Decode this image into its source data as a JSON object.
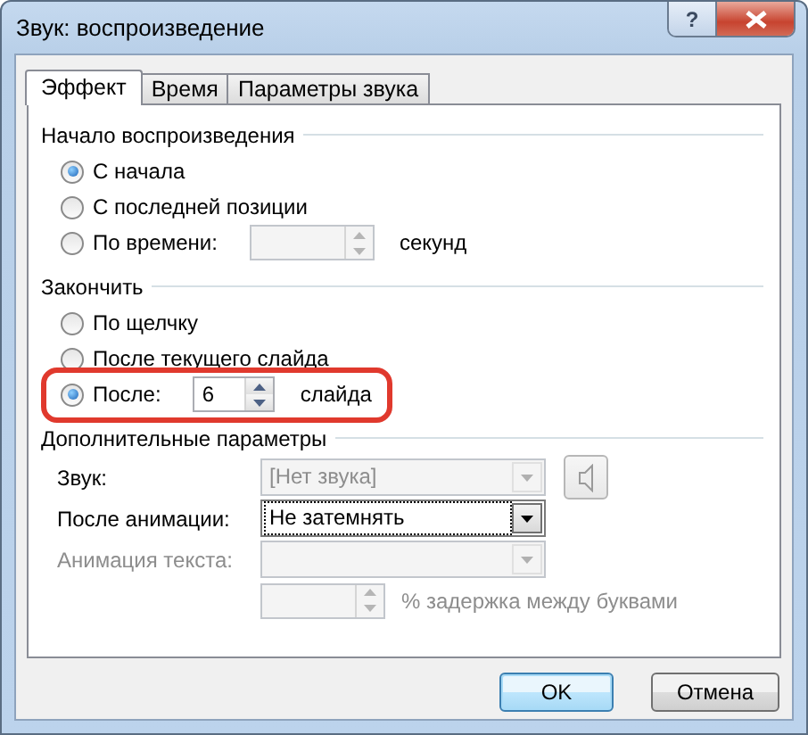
{
  "window": {
    "title": "Звук: воспроизведение",
    "help": "?"
  },
  "tabs": [
    {
      "label": "Эффект",
      "selected": true
    },
    {
      "label": "Время",
      "selected": false
    },
    {
      "label": "Параметры звука",
      "selected": false
    }
  ],
  "groups": [
    {
      "title": "Начало воспроизведения",
      "options": [
        {
          "label": "С начала",
          "selected": true,
          "kind": "plain",
          "highlighted": false
        },
        {
          "label": "С последней позиции",
          "selected": false,
          "kind": "plain",
          "highlighted": false
        },
        {
          "label": "По времени:",
          "selected": false,
          "kind": "spin",
          "field": {
            "disabled": true
          },
          "unit": "секунд",
          "highlighted": false
        }
      ]
    },
    {
      "title": "Закончить",
      "options": [
        {
          "label": "По щелчку",
          "selected": false,
          "kind": "plain",
          "highlighted": false
        },
        {
          "label": "После текущего слайда",
          "selected": false,
          "kind": "plain",
          "highlighted": false
        },
        {
          "label": "После:",
          "selected": true,
          "kind": "spin",
          "field": {
            "value": "6",
            "disabled": false
          },
          "unit": "слайда",
          "highlighted": true
        }
      ]
    }
  ],
  "extra": {
    "title": "Дополнительные параметры",
    "rows": [
      {
        "kind": "combo",
        "label": "Звук:",
        "label_disabled": false,
        "value": "[Нет звука]",
        "disabled": true,
        "focused": false,
        "speaker": true
      },
      {
        "kind": "combo",
        "label": "После анимации:",
        "label_disabled": false,
        "value": "Не затемнять",
        "disabled": false,
        "focused": true,
        "speaker": false
      },
      {
        "kind": "combo",
        "label": "Анимация текста:",
        "label_disabled": true,
        "disabled": true,
        "focused": false,
        "speaker": false
      },
      {
        "kind": "spin",
        "unit": "% задержка между буквами",
        "disabled": true
      }
    ]
  },
  "buttons": [
    {
      "label": "OK",
      "default": true
    },
    {
      "label": "Отмена",
      "default": false
    }
  ]
}
